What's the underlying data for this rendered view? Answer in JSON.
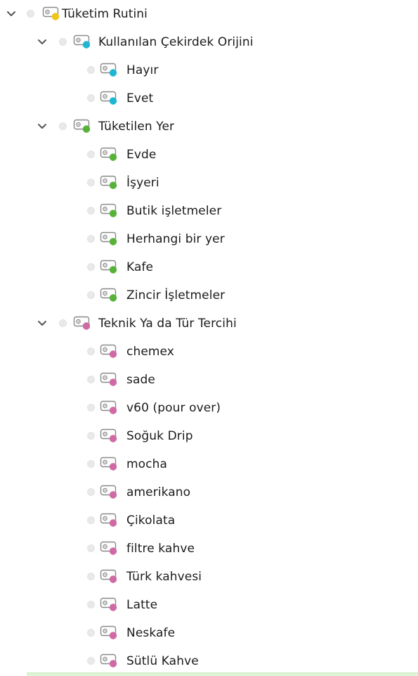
{
  "colors": {
    "yellow": "#f0c419",
    "cyan": "#1fb6d4",
    "green": "#58b23a",
    "pink": "#cf6aa4",
    "selection_bar": "#dff3d6"
  },
  "icons": {
    "expand": "chevron-down-icon",
    "state": "grey-dot-icon",
    "code": "code-tag-icon"
  },
  "tree": [
    {
      "label": "Tüketim Rutini",
      "level": 0,
      "expanded": true,
      "color": "yellow"
    },
    {
      "label": "Kullanılan Çekirdek Orijini",
      "level": 1,
      "expanded": true,
      "color": "cyan"
    },
    {
      "label": "Hayır",
      "level": 2,
      "color": "cyan"
    },
    {
      "label": "Evet",
      "level": 2,
      "color": "cyan"
    },
    {
      "label": "Tüketilen Yer",
      "level": 1,
      "expanded": true,
      "color": "green"
    },
    {
      "label": "Evde",
      "level": 2,
      "color": "green"
    },
    {
      "label": "İşyeri",
      "level": 2,
      "color": "green"
    },
    {
      "label": "Butik işletmeler",
      "level": 2,
      "color": "green"
    },
    {
      "label": "Herhangi bir yer",
      "level": 2,
      "color": "green"
    },
    {
      "label": "Kafe",
      "level": 2,
      "color": "green"
    },
    {
      "label": "Zincir İşletmeler",
      "level": 2,
      "color": "green"
    },
    {
      "label": "Teknik Ya da Tür Tercihi",
      "level": 1,
      "expanded": true,
      "color": "pink"
    },
    {
      "label": "chemex",
      "level": 2,
      "color": "pink"
    },
    {
      "label": "sade",
      "level": 2,
      "color": "pink"
    },
    {
      "label": "v60 (pour over)",
      "level": 2,
      "color": "pink"
    },
    {
      "label": "Soğuk Drip",
      "level": 2,
      "color": "pink"
    },
    {
      "label": "mocha",
      "level": 2,
      "color": "pink"
    },
    {
      "label": "amerikano",
      "level": 2,
      "color": "pink"
    },
    {
      "label": "Çikolata",
      "level": 2,
      "color": "pink"
    },
    {
      "label": "filtre kahve",
      "level": 2,
      "color": "pink"
    },
    {
      "label": "Türk kahvesi",
      "level": 2,
      "color": "pink"
    },
    {
      "label": "Latte",
      "level": 2,
      "color": "pink"
    },
    {
      "label": "Neskafe",
      "level": 2,
      "color": "pink"
    },
    {
      "label": "Sütlü Kahve",
      "level": 2,
      "color": "pink"
    }
  ]
}
